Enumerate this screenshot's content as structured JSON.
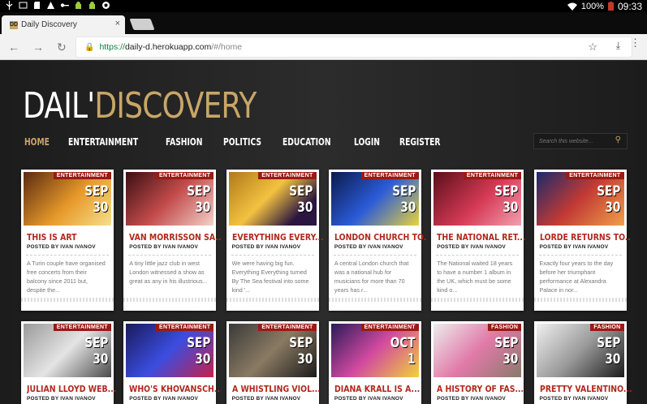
{
  "statusbar": {
    "battery": "100%",
    "time": "09:33"
  },
  "tab": {
    "title": "Daily Discovery",
    "favicon_text": "DD",
    "close": "×"
  },
  "address": {
    "scheme": "https://",
    "host": "daily-d.herokuapp.com",
    "path": "/#/home"
  },
  "site": {
    "logo_part1": "DAIL'",
    "logo_part2": "DISCOVERY",
    "nav": [
      "HOME",
      "ENTERTAINMENT",
      "FASHION",
      "POLITICS",
      "EDUCATION",
      "LOGIN",
      "REGISTER"
    ],
    "search_placeholder": "Search this website..."
  },
  "colors": {
    "accent": "#c9a667",
    "badge": "#9b1a14",
    "title": "#b3271a"
  },
  "cards": [
    {
      "category": "ENTERTAINMENT",
      "month": "SEP",
      "day": "30",
      "title": "THIS IS ART",
      "author": "POSTED BY IVAN IVANOV",
      "excerpt": "A Turin couple have organised free concerts from their balcony since 2011 but, despite the...",
      "bg": "linear-gradient(135deg,#5a2a10,#e89a2b 55%,#f6e08c)"
    },
    {
      "category": "ENTERTAINMENT",
      "month": "SEP",
      "day": "30",
      "title": "VAN MORRISSON SA...",
      "author": "POSTED BY IVAN IVANOV",
      "excerpt": "A tiny little jazz club in west London witnessed a show as great as any in his illustrious...",
      "bg": "linear-gradient(135deg,#3a0f12,#c24a4a 50%,#f2d2c8)"
    },
    {
      "category": "ENTERTAINMENT",
      "month": "SEP",
      "day": "30",
      "title": "EVERYTHING EVERY...",
      "author": "POSTED BY IVAN IVANOV",
      "excerpt": "We were having big fun. Everything Everything turned By The Sea festival into some kind '...",
      "bg": "linear-gradient(135deg,#b0791a,#f3c240 45%,#2a1640 80%)"
    },
    {
      "category": "ENTERTAINMENT",
      "month": "SEP",
      "day": "30",
      "title": "LONDON CHURCH TO...",
      "author": "POSTED BY IVAN IVANOV",
      "excerpt": "A central London church that was a national hub for musicians for more than 70 years has r...",
      "bg": "linear-gradient(135deg,#0b1a4a,#2b5bd8 50%,#e8d33a)"
    },
    {
      "category": "ENTERTAINMENT",
      "month": "SEP",
      "day": "30",
      "title": "THE NATIONAL RET...",
      "author": "POSTED BY IVAN IVANOV",
      "excerpt": "The National waited 18 years to have a number 1 album in the UK, which must be some kind o...",
      "bg": "linear-gradient(135deg,#5c0f1a,#d63a56 55%,#f2a0b0)"
    },
    {
      "category": "ENTERTAINMENT",
      "month": "SEP",
      "day": "30",
      "title": "LORDE RETURNS TO...",
      "author": "POSTED BY IVAN IVANOV",
      "excerpt": "Exactly four years to the day before her triumphant performance at Alexandra Palace in nor...",
      "bg": "linear-gradient(135deg,#1a2a6a,#c23a34 50%,#f0a04a)"
    },
    {
      "category": "ENTERTAINMENT",
      "month": "SEP",
      "day": "30",
      "title": "JULIAN LLOYD WEB...",
      "author": "POSTED BY IVAN IVANOV",
      "excerpt": "",
      "bg": "linear-gradient(135deg,#9a9a9a,#e4e4e4 50%,#4a4a4a)"
    },
    {
      "category": "ENTERTAINMENT",
      "month": "SEP",
      "day": "30",
      "title": "WHO'S KHOVANSCH...",
      "author": "POSTED BY IVAN IVANOV",
      "excerpt": "",
      "bg": "linear-gradient(135deg,#1a1a5a,#3b4de0 50%,#c81f4a)"
    },
    {
      "category": "ENTERTAINMENT",
      "month": "SEP",
      "day": "30",
      "title": "A WHISTLING VIOL...",
      "author": "POSTED BY IVAN IVANOV",
      "excerpt": "",
      "bg": "linear-gradient(135deg,#3a3a3a,#8a7a62 50%,#1a1a1a)"
    },
    {
      "category": "ENTERTAINMENT",
      "month": "OCT",
      "day": "1",
      "title": "DIANA KRALL IS A...",
      "author": "POSTED BY IVAN IVANOV",
      "excerpt": "",
      "bg": "linear-gradient(135deg,#2a1a5a,#d24aa0 50%,#f2d23a)"
    },
    {
      "category": "FASHION",
      "month": "SEP",
      "day": "30",
      "title": "A HISTORY OF FAS...",
      "author": "POSTED BY IVAN IVANOV",
      "excerpt": "",
      "bg": "linear-gradient(135deg,#ececec,#e17aa8 50%,#8a7a6a)"
    },
    {
      "category": "FASHION",
      "month": "SEP",
      "day": "30",
      "title": "PRETTY VALENTINO...",
      "author": "POSTED BY IVAN IVANOV",
      "excerpt": "",
      "bg": "linear-gradient(135deg,#f0f0f0,#9a9a9a 50%,#1a1a1a)"
    }
  ]
}
